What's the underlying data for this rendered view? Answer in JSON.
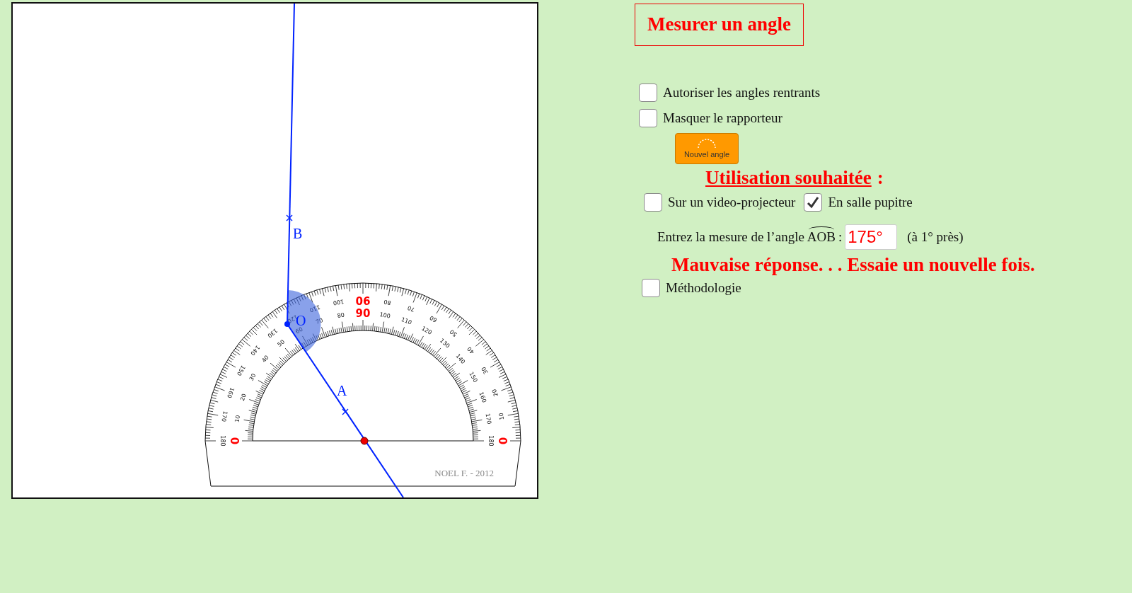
{
  "figure": {
    "points": [
      {
        "label": "B"
      },
      {
        "label": "O"
      },
      {
        "label": "A"
      }
    ],
    "protractor": {
      "outer_labels": [
        "0",
        "10",
        "20",
        "30",
        "40",
        "50",
        "60",
        "70",
        "80",
        "90",
        "100",
        "110",
        "120",
        "130",
        "140",
        "150",
        "160",
        "170",
        "180"
      ],
      "inner_labels": [
        "0",
        "10",
        "20",
        "30",
        "40",
        "50",
        "60",
        "70",
        "80",
        "90",
        "100",
        "110",
        "120",
        "130",
        "140",
        "150",
        "160",
        "170",
        "180"
      ],
      "signature": "NOEL F. - 2012"
    }
  },
  "title": "Mesurer un angle",
  "options": [
    {
      "label": "Autoriser les angles rentrants",
      "checked": false
    },
    {
      "label": "Masquer le rapporteur",
      "checked": false
    }
  ],
  "new_angle_button": {
    "label": "Nouvel angle"
  },
  "usage": {
    "heading": "Utilisation souhaitée",
    "colon": ":",
    "choices": [
      {
        "label": "Sur un video-projecteur",
        "checked": false
      },
      {
        "label": "En salle pupitre",
        "checked": true
      }
    ]
  },
  "answer": {
    "prompt": "Entrez la mesure de l’angle",
    "angle_name": "AOB",
    "separator": ":",
    "value": "175°",
    "precision": "(à 1° près)"
  },
  "feedback": "Mauvaise réponse. . . Essaie un nouvelle fois.",
  "methodology": {
    "label": "Méthodologie",
    "checked": false
  }
}
